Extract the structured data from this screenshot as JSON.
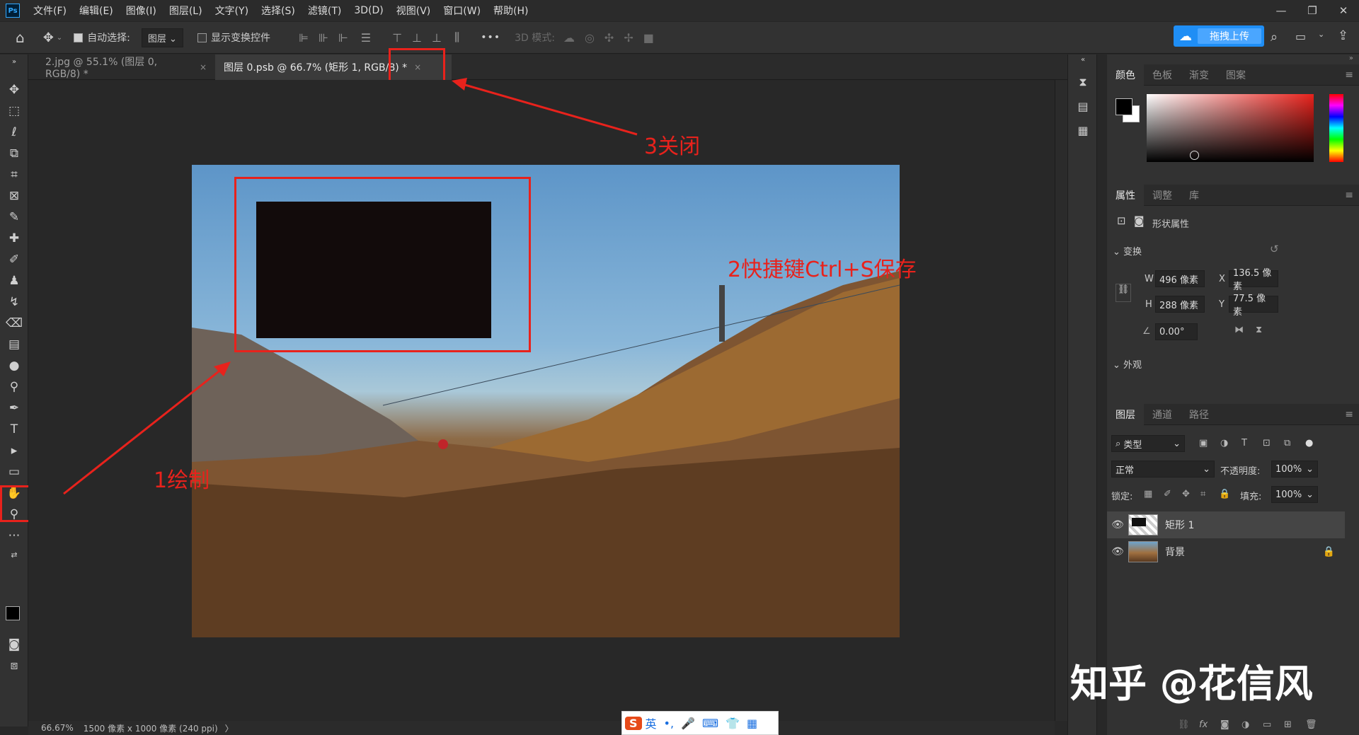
{
  "menubar": {
    "logo": "Ps",
    "items": [
      "文件(F)",
      "编辑(E)",
      "图像(I)",
      "图层(L)",
      "文字(Y)",
      "选择(S)",
      "滤镜(T)",
      "3D(D)",
      "视图(V)",
      "窗口(W)",
      "帮助(H)"
    ]
  },
  "window_controls": [
    "—",
    "❐",
    "✕"
  ],
  "optionsbar": {
    "auto_select_label": "自动选择:",
    "auto_select_value": "图层",
    "show_transform_label": "显示变换控件",
    "more": "•••",
    "mode_3d_label": "3D 模式:",
    "upload_label": "拖拽上传"
  },
  "tabs": [
    {
      "label": "2.jpg @ 55.1% (图层 0, RGB/8) *",
      "close": "×"
    },
    {
      "label": "图层 0.psb @ 66.7% (矩形 1, RGB/8) *",
      "close": "×"
    }
  ],
  "canvas_annotations": {
    "step1": "1绘制",
    "step2": "2快捷键Ctrl+S保存",
    "step3": "3关闭"
  },
  "status": {
    "zoom": "66.67%",
    "doc_info": "1500 像素 x 1000 像素 (240 ppi)",
    "arrow": "〉"
  },
  "color_panel": {
    "tabs": [
      "颜色",
      "色板",
      "渐变",
      "图案"
    ],
    "colors": {
      "foreground": "#000000",
      "background": "#ffffff"
    }
  },
  "properties_panel": {
    "tabs": [
      "属性",
      "调整",
      "库"
    ],
    "shape_label": "形状属性",
    "transform_section": "变换",
    "w_label": "W",
    "w_value": "496 像素",
    "h_label": "H",
    "h_value": "288 像素",
    "x_label": "X",
    "x_value": "136.5 像素",
    "y_label": "Y",
    "y_value": "77.5 像素",
    "angle_value": "0.00°",
    "appearance_section": "外观"
  },
  "layers_panel": {
    "tabs": [
      "图层",
      "通道",
      "路径"
    ],
    "filter_kind": "类型",
    "blend_mode": "正常",
    "opacity_label": "不透明度:",
    "opacity_value": "100%",
    "lock_label": "锁定:",
    "fill_label": "填充:",
    "fill_value": "100%",
    "layers": [
      {
        "name": "矩形 1",
        "selected": true
      },
      {
        "name": "背景",
        "selected": false,
        "locked": true
      }
    ]
  },
  "ime": {
    "logo": "S",
    "lang": "英",
    "items": [
      "•,",
      "🎤",
      "⌨",
      "👕",
      "▦"
    ]
  },
  "watermark": "知乎 @花信风"
}
